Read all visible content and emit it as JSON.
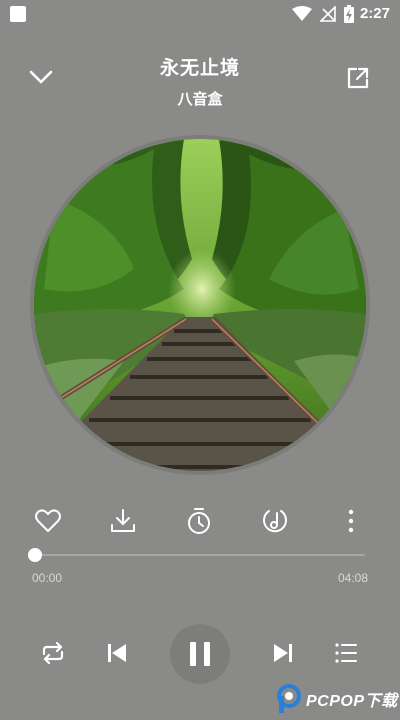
{
  "status_bar": {
    "time": "2:27",
    "icons": [
      "notification-square-icon",
      "wifi-icon",
      "no-signal-icon",
      "battery-charging-icon"
    ]
  },
  "header": {
    "title": "永无止境",
    "artist": "八音盒",
    "collapse_icon": "chevron-down-icon",
    "share_icon": "share-external-icon"
  },
  "disc": {
    "artwork": "railway-through-forest"
  },
  "actions": [
    {
      "name": "favorite",
      "icon": "heart-icon"
    },
    {
      "name": "download",
      "icon": "download-icon"
    },
    {
      "name": "sleep-timer",
      "icon": "timer-icon"
    },
    {
      "name": "sound-effect",
      "icon": "music-disc-icon"
    },
    {
      "name": "more",
      "icon": "more-vertical-icon"
    }
  ],
  "progress": {
    "elapsed": "00:00",
    "duration": "04:08",
    "fraction": 0.0
  },
  "controls": {
    "repeat_icon": "repeat-icon",
    "prev_icon": "skip-previous-icon",
    "play_state": "playing",
    "pause_icon": "pause-icon",
    "next_icon": "skip-next-icon",
    "playlist_icon": "playlist-icon"
  },
  "watermark": {
    "text": "PCPOP下载"
  },
  "colors": {
    "background": "#8a8a88",
    "play_button": "#7d7d7b",
    "foreground": "#ffffff"
  }
}
